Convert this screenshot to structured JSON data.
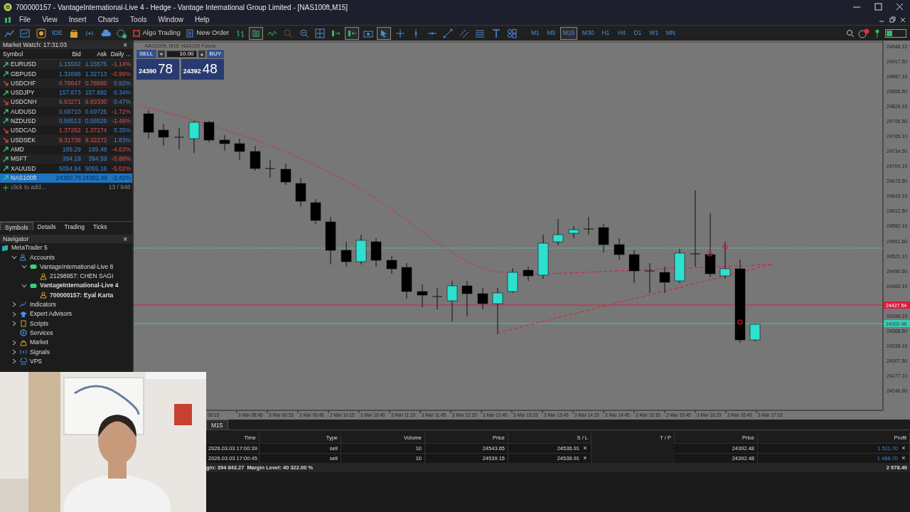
{
  "window": {
    "title": "700000157 - VantageInternational-Live 4 - Hedge - Vantage International Group Limited - [NAS100ft,M15]"
  },
  "menu": [
    "File",
    "View",
    "Insert",
    "Charts",
    "Tools",
    "Window",
    "Help"
  ],
  "toolbar": {
    "ide": "IDE",
    "algo_trading": "Algo Trading",
    "new_order": "New Order",
    "timeframes": [
      {
        "label": "M1",
        "selected": false
      },
      {
        "label": "M5",
        "selected": false
      },
      {
        "label": "M15",
        "selected": true
      },
      {
        "label": "M30",
        "selected": false
      },
      {
        "label": "H1",
        "selected": false
      },
      {
        "label": "H4",
        "selected": false
      },
      {
        "label": "D1",
        "selected": false
      },
      {
        "label": "W1",
        "selected": false
      },
      {
        "label": "MN",
        "selected": false
      }
    ]
  },
  "market_watch": {
    "title": "Market Watch: 17:31:03",
    "close": "×",
    "columns": [
      "Symbol",
      "Bid",
      "Ask",
      "Daily ..."
    ],
    "rows": [
      {
        "symbol": "EURUSD",
        "bid": "1.15562",
        "ask": "1.15575",
        "daily": "-1.14%",
        "rising": true,
        "daily_up": false,
        "selected": false
      },
      {
        "symbol": "GBPUSD",
        "bid": "1.32698",
        "ask": "1.32713",
        "daily": "-0.99%",
        "rising": true,
        "daily_up": false,
        "selected": false
      },
      {
        "symbol": "USDCHF",
        "bid": "0.78647",
        "ask": "0.78660",
        "daily": "0.92%",
        "rising": false,
        "daily_up": true,
        "selected": false
      },
      {
        "symbol": "USDJPY",
        "bid": "157.873",
        "ask": "157.892",
        "daily": "0.34%",
        "rising": true,
        "daily_up": true,
        "selected": false
      },
      {
        "symbol": "USDCNH",
        "bid": "6.93271",
        "ask": "6.93330",
        "daily": "0.47%",
        "rising": false,
        "daily_up": true,
        "selected": false
      },
      {
        "symbol": "AUDUSD",
        "bid": "0.69710",
        "ask": "0.69725",
        "daily": "-1.72%",
        "rising": true,
        "daily_up": false,
        "selected": false
      },
      {
        "symbol": "NZDUSD",
        "bid": "0.58513",
        "ask": "0.58529",
        "daily": "-1.49%",
        "rising": true,
        "daily_up": false,
        "selected": false
      },
      {
        "symbol": "USDCAD",
        "bid": "1.37262",
        "ask": "1.37274",
        "daily": "0.35%",
        "rising": false,
        "daily_up": true,
        "selected": false
      },
      {
        "symbol": "USDSEK",
        "bid": "9.31738",
        "ask": "9.32272",
        "daily": "1.83%",
        "rising": false,
        "daily_up": true,
        "selected": false
      },
      {
        "symbol": "AMD",
        "bid": "189.29",
        "ask": "189.48",
        "daily": "-4.63%",
        "rising": true,
        "daily_up": false,
        "selected": false
      },
      {
        "symbol": "MSFT",
        "bid": "394.19",
        "ask": "394.59",
        "daily": "-0.88%",
        "rising": true,
        "daily_up": false,
        "selected": false
      },
      {
        "symbol": "XAUUSD",
        "bid": "5054.94",
        "ask": "5055.16",
        "daily": "-5.02%",
        "rising": true,
        "daily_up": false,
        "selected": false
      },
      {
        "symbol": "NAS100ft",
        "bid": "24390.78",
        "ask": "24392.48",
        "daily": "-2.42%",
        "rising": true,
        "daily_up": false,
        "selected": true
      }
    ],
    "add": "click to add...",
    "count": "13 / 948",
    "tabs": [
      {
        "label": "Symbols",
        "selected": true
      },
      {
        "label": "Details",
        "selected": false
      },
      {
        "label": "Trading",
        "selected": false
      },
      {
        "label": "Ticks",
        "selected": false
      }
    ]
  },
  "navigator": {
    "title": "Navigator",
    "close": "×",
    "tree": [
      {
        "label": "MetaTrader 5",
        "kind": "terminal",
        "children": [
          {
            "label": "Accounts",
            "kind": "accounts",
            "expanded": true,
            "children": [
              {
                "label": "VantageInternational-Live 8",
                "kind": "server",
                "expanded": true,
                "active": false,
                "children": [
                  {
                    "label": "21298957: CHEN SAGI",
                    "kind": "account",
                    "active": false
                  }
                ]
              },
              {
                "label": "VantageInternational-Live 4",
                "kind": "server",
                "expanded": true,
                "active": true,
                "children": [
                  {
                    "label": "700000157: Eyal Karta",
                    "kind": "account",
                    "active": true
                  }
                ]
              }
            ]
          },
          {
            "label": "Indicators",
            "kind": "indicators",
            "expanded": false
          },
          {
            "label": "Expert Advisors",
            "kind": "experts",
            "expanded": false
          },
          {
            "label": "Scripts",
            "kind": "scripts",
            "expanded": false
          },
          {
            "label": "Services",
            "kind": "services"
          },
          {
            "label": "Market",
            "kind": "market",
            "expanded": false
          },
          {
            "label": "Signals",
            "kind": "signals",
            "expanded": false
          },
          {
            "label": "VPS",
            "kind": "vps",
            "expanded": false
          }
        ]
      }
    ]
  },
  "chart": {
    "header": "NAS100ft, M15: NAS100 Future",
    "trade_panel": {
      "sell": "SELL",
      "buy": "BUY",
      "volume": "10.00",
      "bid_small": "24390",
      "bid_big": "78",
      "ask_small": "24392",
      "ask_big": "48"
    },
    "price_axis": [
      "24948.10",
      "24917.50",
      "24887.10",
      "24856.50",
      "24826.10",
      "24795.50",
      "24765.10",
      "24734.50",
      "24704.10",
      "24673.50",
      "24643.10",
      "24612.50",
      "24582.10",
      "24551.50",
      "24521.10",
      "24490.50",
      "24460.10",
      "24399.10",
      "24368.50",
      "24338.10",
      "24307.50",
      "24277.10",
      "24246.50"
    ],
    "price_markers": [
      {
        "label": "24427.54",
        "color": "#e3173e"
      },
      {
        "label": "24392.48",
        "color": "#3fc9b4"
      }
    ],
    "time_axis": [
      "08:15",
      "3 Mar 08:45",
      "3 Mar 09:15",
      "3 Mar 09:45",
      "3 Mar 10:15",
      "3 Mar 10:45",
      "3 Mar 11:15",
      "3 Mar 11:45",
      "3 Mar 12:15",
      "3 Mar 12:45",
      "3 Mar 13:15",
      "3 Mar 13:45",
      "3 Mar 14:15",
      "3 Mar 14:45",
      "3 Mar 15:15",
      "3 Mar 15:45",
      "3 Mar 16:15",
      "3 Mar 16:45",
      "3 Mar 17:15"
    ],
    "tab": "M15"
  },
  "toolbox": {
    "columns": [
      "Time",
      "Type",
      "Volume",
      "Price",
      "S / L",
      "T / P",
      "Price",
      "Profit"
    ],
    "rows": [
      {
        "time": "2026.03.03 17:00:39",
        "type": "sell",
        "volume": "10",
        "price": "24543.65",
        "sl": "24536.91",
        "sl_clear": "×",
        "current": "24392.48",
        "profit": "1 511.70",
        "close": "×"
      },
      {
        "time": "2026.03.03 17:00:45",
        "type": "sell",
        "volume": "10",
        "price": "24539.15",
        "sl": "24536.91",
        "sl_clear": "×",
        "current": "24392.48",
        "profit": "1 466.70",
        "close": "×"
      }
    ],
    "footer": "gin: 394 843.27  Margin Level: 40 322.00 %",
    "total": "2 978.40"
  }
}
